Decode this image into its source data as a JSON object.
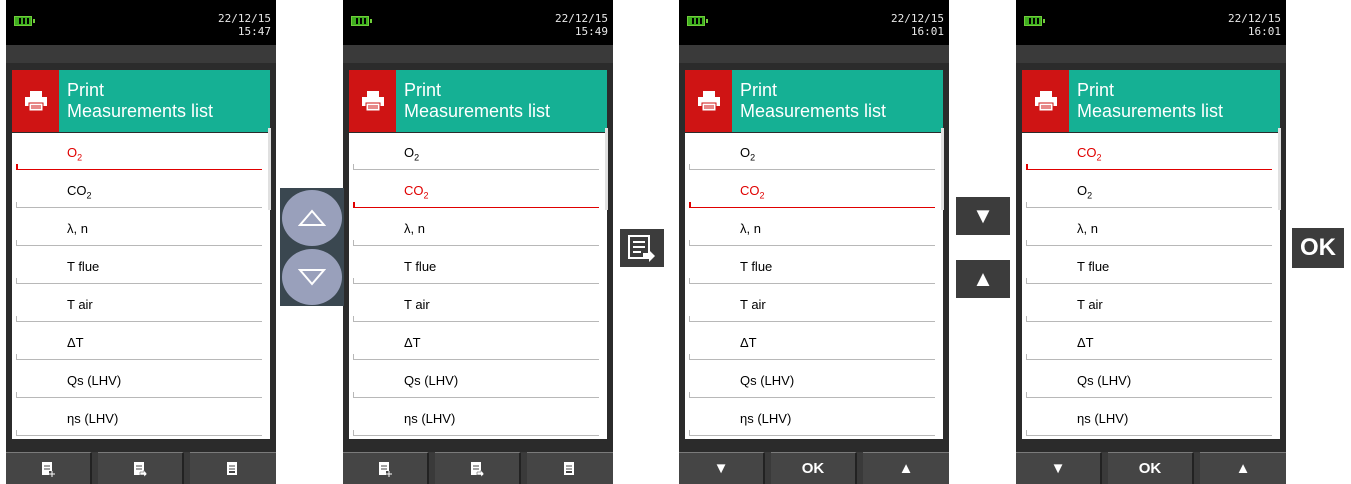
{
  "screens": [
    {
      "datetime": {
        "date": "22/12/15",
        "time": "15:47"
      },
      "header": {
        "title": "Print",
        "subtitle": "Measurements list"
      },
      "items": [
        {
          "label": "O",
          "sub": "2",
          "rest": "",
          "selected": true
        },
        {
          "label": "CO",
          "sub": "2",
          "rest": "",
          "selected": false
        },
        {
          "label": "λ, n",
          "sub": "",
          "rest": "",
          "selected": false
        },
        {
          "label": "T flue",
          "sub": "",
          "rest": "",
          "selected": false
        },
        {
          "label": "T air",
          "sub": "",
          "rest": "",
          "selected": false
        },
        {
          "label": "ΔT",
          "sub": "",
          "rest": "",
          "selected": false
        },
        {
          "label": "Qs (LHV)",
          "sub": "",
          "rest": "",
          "selected": false
        },
        {
          "label": "ηs (LHV)",
          "sub": "",
          "rest": "",
          "selected": false
        }
      ],
      "softkeys": [
        {
          "type": "icon",
          "icon": "doc-add-icon"
        },
        {
          "type": "icon",
          "icon": "doc-arrow-icon"
        },
        {
          "type": "icon",
          "icon": "doc-minus-icon"
        }
      ]
    },
    {
      "datetime": {
        "date": "22/12/15",
        "time": "15:49"
      },
      "header": {
        "title": "Print",
        "subtitle": "Measurements list"
      },
      "items": [
        {
          "label": "O",
          "sub": "2",
          "rest": "",
          "selected": false
        },
        {
          "label": "CO",
          "sub": "2",
          "rest": "",
          "selected": true
        },
        {
          "label": "λ, n",
          "sub": "",
          "rest": "",
          "selected": false
        },
        {
          "label": "T flue",
          "sub": "",
          "rest": "",
          "selected": false
        },
        {
          "label": "T air",
          "sub": "",
          "rest": "",
          "selected": false
        },
        {
          "label": "ΔT",
          "sub": "",
          "rest": "",
          "selected": false
        },
        {
          "label": "Qs (LHV)",
          "sub": "",
          "rest": "",
          "selected": false
        },
        {
          "label": "ηs (LHV)",
          "sub": "",
          "rest": "",
          "selected": false
        }
      ],
      "softkeys": [
        {
          "type": "icon",
          "icon": "doc-add-icon"
        },
        {
          "type": "icon",
          "icon": "doc-arrow-icon"
        },
        {
          "type": "icon",
          "icon": "doc-minus-icon"
        }
      ]
    },
    {
      "datetime": {
        "date": "22/12/15",
        "time": "16:01"
      },
      "header": {
        "title": "Print",
        "subtitle": "Measurements list"
      },
      "items": [
        {
          "label": "O",
          "sub": "2",
          "rest": "",
          "selected": false
        },
        {
          "label": "CO",
          "sub": "2",
          "rest": "",
          "selected": true
        },
        {
          "label": "λ, n",
          "sub": "",
          "rest": "",
          "selected": false
        },
        {
          "label": "T flue",
          "sub": "",
          "rest": "",
          "selected": false
        },
        {
          "label": "T air",
          "sub": "",
          "rest": "",
          "selected": false
        },
        {
          "label": "ΔT",
          "sub": "",
          "rest": "",
          "selected": false
        },
        {
          "label": "Qs (LHV)",
          "sub": "",
          "rest": "",
          "selected": false
        },
        {
          "label": "ηs (LHV)",
          "sub": "",
          "rest": "",
          "selected": false
        }
      ],
      "softkeys": [
        {
          "type": "text",
          "text": "▼"
        },
        {
          "type": "text",
          "text": "OK"
        },
        {
          "type": "text",
          "text": "▲"
        }
      ]
    },
    {
      "datetime": {
        "date": "22/12/15",
        "time": "16:01"
      },
      "header": {
        "title": "Print",
        "subtitle": "Measurements list"
      },
      "items": [
        {
          "label": "CO",
          "sub": "2",
          "rest": "",
          "selected": true
        },
        {
          "label": "O",
          "sub": "2",
          "rest": "",
          "selected": false
        },
        {
          "label": "λ, n",
          "sub": "",
          "rest": "",
          "selected": false
        },
        {
          "label": "T flue",
          "sub": "",
          "rest": "",
          "selected": false
        },
        {
          "label": "T air",
          "sub": "",
          "rest": "",
          "selected": false
        },
        {
          "label": "ΔT",
          "sub": "",
          "rest": "",
          "selected": false
        },
        {
          "label": "Qs (LHV)",
          "sub": "",
          "rest": "",
          "selected": false
        },
        {
          "label": "ηs (LHV)",
          "sub": "",
          "rest": "",
          "selected": false
        }
      ],
      "softkeys": [
        {
          "type": "text",
          "text": "▼"
        },
        {
          "type": "text",
          "text": "OK"
        },
        {
          "type": "text",
          "text": "▲"
        }
      ]
    }
  ],
  "between": {
    "updown": {
      "up_icon": "triangle-up-outline-icon",
      "down_icon": "triangle-down-outline-icon"
    },
    "list_button": {
      "icon": "list-arrow-icon"
    },
    "arrow_buttons": {
      "down": "▼",
      "up": "▲"
    },
    "ok_button": "OK"
  },
  "colors": {
    "header_teal": "#15b094",
    "icon_red": "#cf1414",
    "selected_red": "#e00000",
    "battery_green": "#3fae1f"
  }
}
